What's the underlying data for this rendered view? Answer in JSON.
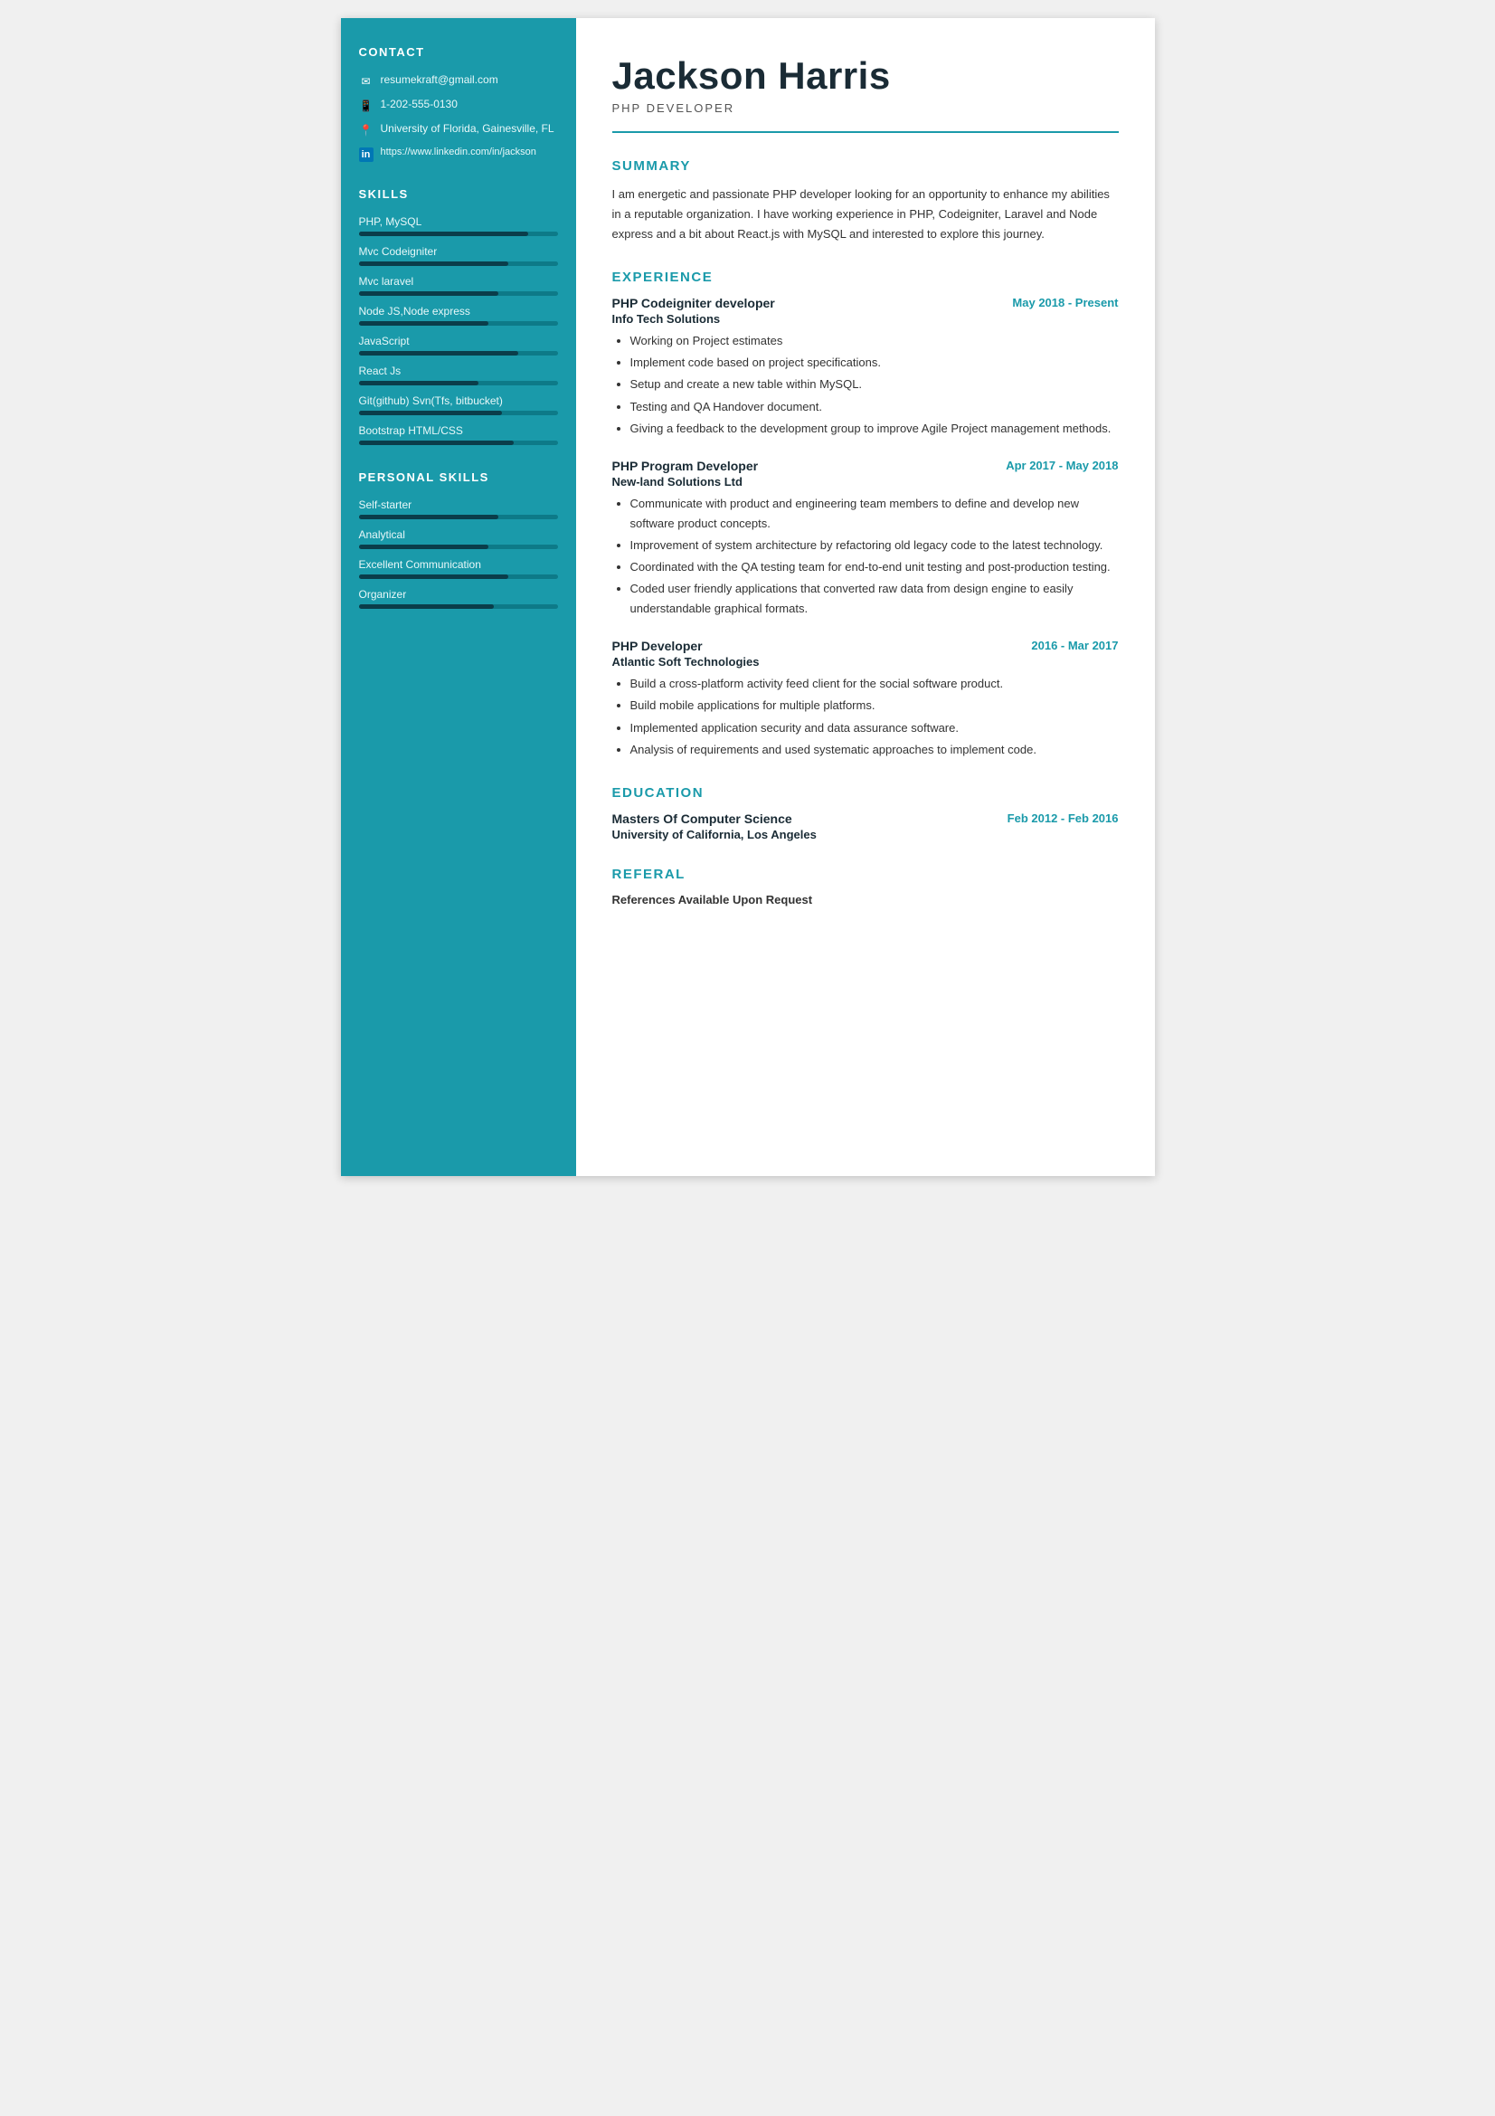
{
  "sidebar": {
    "contact_title": "CONTACT",
    "email": "resumekraft@gmail.com",
    "phone": "1-202-555-0130",
    "address": "University of Florida, Gainesville, FL",
    "linkedin": "https://www.linkedin.com/in/jackson",
    "skills_title": "SKILLS",
    "skills": [
      {
        "label": "PHP, MySQL",
        "percent": 85
      },
      {
        "label": "Mvc Codeigniter",
        "percent": 75
      },
      {
        "label": "Mvc laravel",
        "percent": 70
      },
      {
        "label": "Node JS,Node express",
        "percent": 65
      },
      {
        "label": "JavaScript",
        "percent": 80
      },
      {
        "label": "React Js",
        "percent": 60
      },
      {
        "label": "Git(github) Svn(Tfs, bitbucket)",
        "percent": 72
      },
      {
        "label": "Bootstrap HTML/CSS",
        "percent": 78
      }
    ],
    "personal_skills_title": "PERSONAL SKILLS",
    "personal_skills": [
      {
        "label": "Self-starter",
        "percent": 70
      },
      {
        "label": "Analytical",
        "percent": 65
      },
      {
        "label": "Excellent Communication",
        "percent": 75
      },
      {
        "label": "Organizer",
        "percent": 68
      }
    ]
  },
  "main": {
    "name": "Jackson Harris",
    "title": "PHP DEVELOPER",
    "summary_title": "SUMMARY",
    "summary_text": "I am energetic and passionate PHP developer looking for an opportunity to enhance my abilities in a reputable organization. I have working experience in PHP, Codeigniter, Laravel and Node express and a bit about React.js with MySQL and interested to explore this journey.",
    "experience_title": "EXPERIENCE",
    "experiences": [
      {
        "role": "PHP Codeigniter developer",
        "date": "May 2018 - Present",
        "company": "Info Tech Solutions",
        "bullets": [
          "Working on Project estimates",
          "Implement code based on project specifications.",
          "Setup and create a new table within MySQL.",
          "Testing and QA Handover document.",
          "Giving a feedback to the development group to improve Agile Project management methods."
        ]
      },
      {
        "role": "PHP Program Developer",
        "date": "Apr 2017 - May 2018",
        "company": "New-land Solutions Ltd",
        "bullets": [
          "Communicate with product and engineering team members to define and develop new software product concepts.",
          "Improvement of system architecture by refactoring old legacy code to the latest technology.",
          "Coordinated with the QA testing team for end-to-end unit testing and post-production testing.",
          "Coded user friendly applications that converted raw data from design engine to easily understandable graphical formats."
        ]
      },
      {
        "role": "PHP Developer",
        "date": "2016 - Mar 2017",
        "company": "Atlantic Soft Technologies",
        "bullets": [
          "Build a cross-platform activity feed client for the social software product.",
          "Build mobile applications for multiple platforms.",
          "Implemented application security and data assurance software.",
          "Analysis of requirements and used systematic approaches to implement code."
        ]
      }
    ],
    "education_title": "EDUCATION",
    "education": [
      {
        "degree": "Masters Of Computer Science",
        "school": "University of California, Los Angeles",
        "date": "Feb 2012 - Feb 2016"
      }
    ],
    "referal_title": "REFERAL",
    "referal_text": "References Available Upon Request"
  }
}
